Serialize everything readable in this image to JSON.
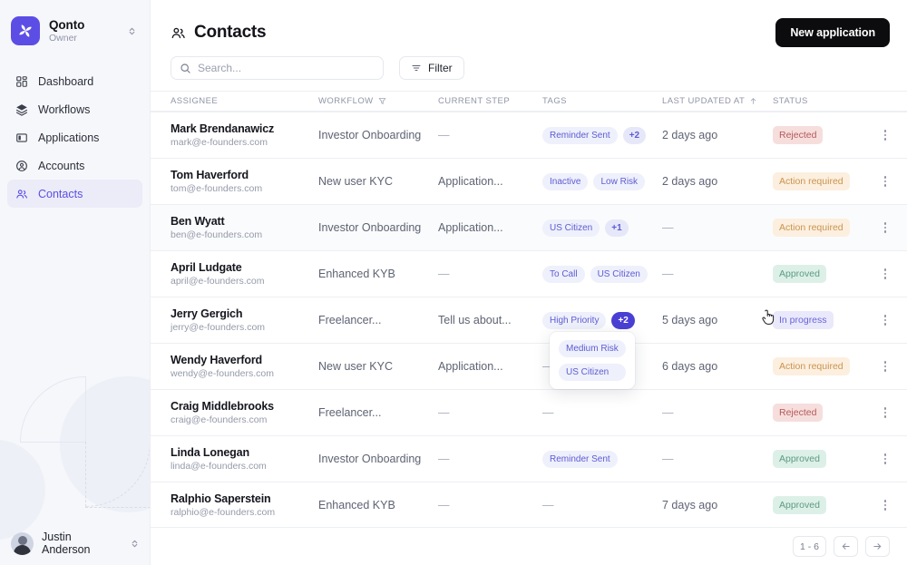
{
  "sidebar": {
    "org": {
      "name": "Qonto",
      "role": "Owner",
      "logo_icon": "qonto-pinwheel-logo",
      "switch_icon": "chevron-up-down-icon"
    },
    "items": [
      {
        "label": "Dashboard",
        "icon": "dashboard-grid-icon",
        "active": false
      },
      {
        "label": "Workflows",
        "icon": "layers-stack-icon",
        "active": false
      },
      {
        "label": "Applications",
        "icon": "window-panel-icon",
        "active": false
      },
      {
        "label": "Accounts",
        "icon": "user-circle-icon",
        "active": false
      },
      {
        "label": "Contacts",
        "icon": "users-group-icon",
        "active": true
      }
    ],
    "user": {
      "name": "Justin Anderson",
      "avatar_icon": "avatar",
      "switch_icon": "chevron-up-down-icon"
    },
    "accent_color": "#5c4ee5",
    "active_bg": "#ebecf8"
  },
  "header": {
    "title": "Contacts",
    "title_icon": "users-group-icon",
    "new_application_label": "New application"
  },
  "toolbar": {
    "search_placeholder": "Search...",
    "search_value": "",
    "search_icon": "search-icon",
    "filter_label": "Filter",
    "filter_icon": "filter-lines-icon"
  },
  "table": {
    "columns": [
      {
        "key": "assignee",
        "label": "Assignee"
      },
      {
        "key": "workflow",
        "label": "Workflow",
        "icon": "funnel-filter-icon"
      },
      {
        "key": "current_step",
        "label": "Current step"
      },
      {
        "key": "tags",
        "label": "Tags"
      },
      {
        "key": "last_updated_at",
        "label": "Last updated at",
        "icon": "arrow-up-sort-icon"
      },
      {
        "key": "status",
        "label": "Status"
      }
    ],
    "rows": [
      {
        "name": "Mark Brendanawicz",
        "email": "mark@e-founders.com",
        "workflow": "Investor Onboarding",
        "current_step": "—",
        "tags": [
          "Reminder Sent"
        ],
        "more": "+2",
        "last_updated_at": "2 days ago",
        "status": "Rejected",
        "status_kind": "rejected",
        "highlighted": false
      },
      {
        "name": "Tom Haverford",
        "email": "tom@e-founders.com",
        "workflow": "New user KYC",
        "current_step": "Application...",
        "tags": [
          "Inactive",
          "Low Risk"
        ],
        "more": "",
        "last_updated_at": "2 days ago",
        "status": "Action required",
        "status_kind": "action",
        "highlighted": false
      },
      {
        "name": "Ben Wyatt",
        "email": "ben@e-founders.com",
        "workflow": "Investor Onboarding",
        "current_step": "Application...",
        "tags": [
          "US Citizen"
        ],
        "more": "+1",
        "last_updated_at": "—",
        "status": "Action required",
        "status_kind": "action",
        "highlighted": true
      },
      {
        "name": "April Ludgate",
        "email": "april@e-founders.com",
        "workflow": "Enhanced KYB",
        "current_step": "—",
        "tags": [
          "To Call",
          "US Citizen"
        ],
        "more": "",
        "last_updated_at": "—",
        "status": "Approved",
        "status_kind": "approved",
        "highlighted": false
      },
      {
        "name": "Jerry Gergich",
        "email": "jerry@e-founders.com",
        "workflow": "Freelancer...",
        "current_step": "Tell us about...",
        "tags": [
          "High Priority"
        ],
        "more": "+2",
        "last_updated_at": "5 days ago",
        "status": "In progress",
        "status_kind": "progress",
        "highlighted": false,
        "more_hovered": true,
        "popover_tags": [
          "Medium Risk",
          "US Citizen"
        ]
      },
      {
        "name": "Wendy Haverford",
        "email": "wendy@e-founders.com",
        "workflow": "New user KYC",
        "current_step": "Application...",
        "tags": [],
        "more": "",
        "last_updated_at": "6 days ago",
        "status": "Action required",
        "status_kind": "action",
        "highlighted": false,
        "tags_dash": "—"
      },
      {
        "name": "Craig Middlebrooks",
        "email": "craig@e-founders.com",
        "workflow": "Freelancer...",
        "current_step": "—",
        "tags": [],
        "more": "",
        "last_updated_at": "—",
        "status": "Rejected",
        "status_kind": "rejected",
        "highlighted": false,
        "tags_dash": "—"
      },
      {
        "name": "Linda Lonegan",
        "email": "linda@e-founders.com",
        "workflow": "Investor Onboarding",
        "current_step": "—",
        "tags": [
          "Reminder Sent"
        ],
        "more": "",
        "last_updated_at": "—",
        "status": "Approved",
        "status_kind": "approved",
        "highlighted": false
      },
      {
        "name": "Ralphio Saperstein",
        "email": "ralphio@e-founders.com",
        "workflow": "Enhanced KYB",
        "current_step": "—",
        "tags": [],
        "more": "",
        "last_updated_at": "7 days ago",
        "status": "Approved",
        "status_kind": "approved",
        "highlighted": false,
        "tags_dash": "—"
      }
    ],
    "row_menu_icon": "kebab-menu-icon"
  },
  "pagination": {
    "range": "1 - 6",
    "prev_icon": "arrow-left-icon",
    "next_icon": "arrow-right-icon"
  },
  "colors": {
    "accent": "#5c4ee5",
    "tag_bg": "#eef0fb",
    "tag_text": "#5e5bd4",
    "rejected": "#b5595a",
    "action": "#c99450",
    "approved": "#5c9b84",
    "progress": "#6a64d8"
  }
}
